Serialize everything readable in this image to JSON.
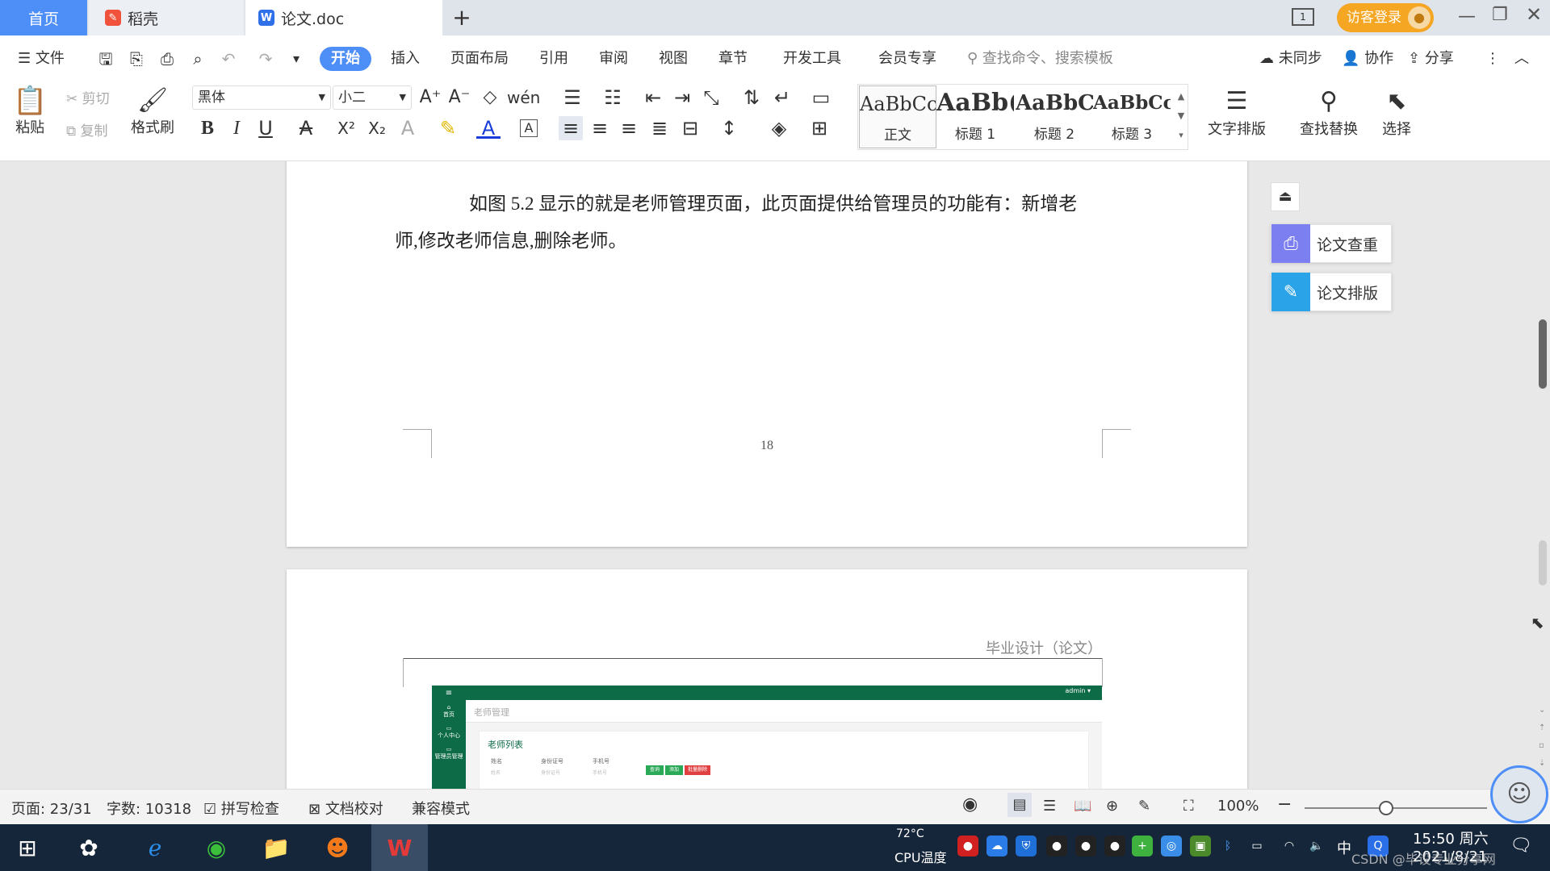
{
  "tabs": {
    "home": "首页",
    "daoke": "稻壳",
    "doc": "论文.doc",
    "add": "+"
  },
  "titlebar": {
    "login": "访客登录"
  },
  "menu": {
    "file": "文件",
    "items": [
      "开始",
      "插入",
      "页面布局",
      "引用",
      "审阅",
      "视图",
      "章节",
      "开发工具",
      "会员专享"
    ],
    "search_placeholder": "查找命令、搜索模板",
    "unsynced": "未同步",
    "collab": "协作",
    "share": "分享"
  },
  "ribbon": {
    "paste": "粘贴",
    "cut": "剪切",
    "copy": "复制",
    "format_painter": "格式刷",
    "font_name": "黑体",
    "font_size": "小二",
    "styles": [
      {
        "preview": "AaBbCcI",
        "label": "正文"
      },
      {
        "preview": "AaBb(",
        "label": "标题 1"
      },
      {
        "preview": "AaBbC",
        "label": "标题 2"
      },
      {
        "preview": "AaBbCcl",
        "label": "标题 3"
      }
    ],
    "text_layout": "文字排版",
    "find_replace": "查找替换",
    "select": "选择"
  },
  "document": {
    "para_line1": "如图 5.2 显示的就是老师管理页面，此页面提供给管理员的功能有：新增老",
    "para_line2": "师,修改老师信息,删除老师。",
    "page_number": "18",
    "header_text": "毕业设计（论文）",
    "figure": {
      "admin": "admin ▾",
      "breadcrumb": "老师管理",
      "list_title": "老师列表",
      "fields": [
        "姓名",
        "身份证号",
        "手机号"
      ],
      "placeholders": [
        "姓名",
        "身份证号",
        "手机号"
      ],
      "buttons": [
        "查询",
        "添加",
        "批量删除"
      ],
      "nav": [
        "首页",
        "个人中心",
        "管理员管理"
      ]
    }
  },
  "side_panel": {
    "check": "论文查重",
    "layout": "论文排版"
  },
  "status": {
    "page": "页面: 23/31",
    "words": "字数: 10318",
    "spell": "拼写检查",
    "proofread": "文档校对",
    "compat": "兼容模式",
    "zoom": "100%"
  },
  "taskbar": {
    "cpu_temp": "72°C",
    "cpu_label": "CPU温度",
    "ime": "中",
    "time": "15:50 周六",
    "date": "2021/8/21",
    "watermark": "CSDN @毕设专业分享网"
  },
  "colors": {
    "accent": "#4e8ef7",
    "login": "#f5a623",
    "taskbar": "#16263a",
    "figure_green": "#0d6b48"
  }
}
